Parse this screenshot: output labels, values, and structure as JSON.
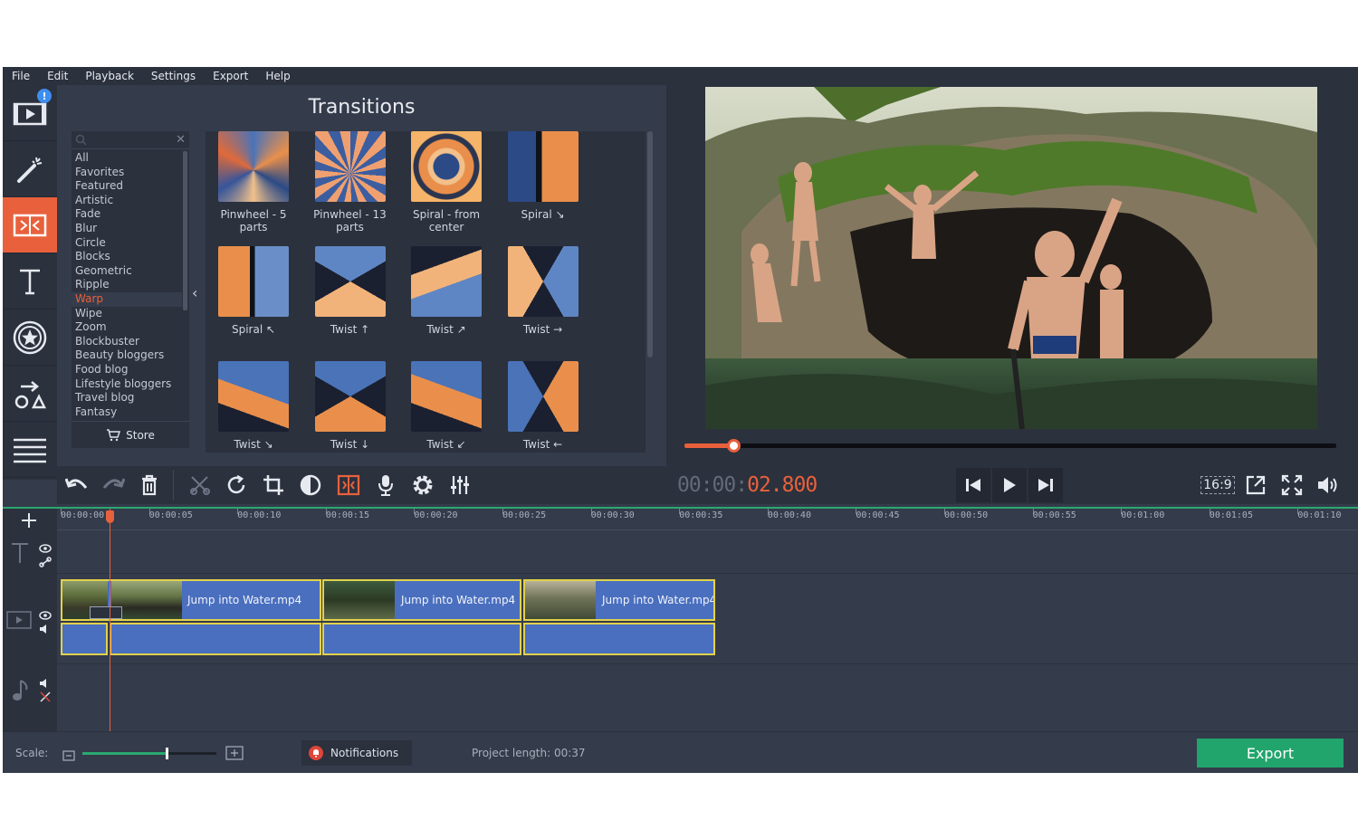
{
  "menu": [
    "File",
    "Edit",
    "Playback",
    "Settings",
    "Export",
    "Help"
  ],
  "left_tools": [
    {
      "icon": "import-media-icon",
      "badge": "!"
    },
    {
      "icon": "magic-wand-icon"
    },
    {
      "icon": "transitions-icon",
      "active": true
    },
    {
      "icon": "titles-icon"
    },
    {
      "icon": "stickers-icon"
    },
    {
      "icon": "shapes-icon"
    },
    {
      "icon": "more-menu-icon"
    }
  ],
  "transitions": {
    "title": "Transitions",
    "categories": [
      "All",
      "Favorites",
      "Featured",
      "Artistic",
      "Fade",
      "Blur",
      "Circle",
      "Blocks",
      "Geometric",
      "Ripple",
      "Warp",
      "Wipe",
      "Zoom",
      "Blockbuster",
      "Beauty bloggers",
      "Food blog",
      "Lifestyle bloggers",
      "Travel blog",
      "Fantasy"
    ],
    "active_category": "Warp",
    "store_label": "Store",
    "items": [
      {
        "label": "Pinwheel - 5 parts",
        "style": "pinwheel"
      },
      {
        "label": "Pinwheel - 13 parts",
        "style": "pinwheel13"
      },
      {
        "label": "Spiral - from center",
        "style": "spiralcenter"
      },
      {
        "label": "Spiral ↘",
        "style": "spiral1"
      },
      {
        "label": "Spiral ↖",
        "style": "spiral2"
      },
      {
        "label": "Twist ↑",
        "style": "twistup"
      },
      {
        "label": "Twist ↗",
        "style": "twistne"
      },
      {
        "label": "Twist →",
        "style": "twistr"
      },
      {
        "label": "Twist ↘",
        "style": "twistse"
      },
      {
        "label": "Twist ↓",
        "style": "twistdown"
      },
      {
        "label": "Twist ↙",
        "style": "twistsw"
      },
      {
        "label": "Twist ←",
        "style": "twistl"
      }
    ]
  },
  "player": {
    "timecode_dim": "00:00:",
    "timecode_hi": "02.800",
    "progress": 0.075,
    "aspect": "16:9"
  },
  "timeline": {
    "ticks": [
      "00:00:00",
      "00:00:05",
      "00:00:10",
      "00:00:15",
      "00:00:20",
      "00:00:25",
      "00:00:30",
      "00:00:35",
      "00:00:40",
      "00:00:45",
      "00:00:50",
      "00:00:55",
      "00:01:00",
      "00:01:05",
      "00:01:10"
    ],
    "clips": [
      {
        "name": "Jump into Water.mp4"
      },
      {
        "name": "Jump into Water.mp4"
      },
      {
        "name": "Jump into Water.mp4"
      }
    ]
  },
  "status": {
    "scale_label": "Scale:",
    "scale_value": 0.62,
    "notifications_label": "Notifications",
    "project_length": "Project length:  00:37",
    "export_label": "Export"
  },
  "colors": {
    "accent": "#e8613c",
    "export": "#22a56c",
    "clip": "#4a6fbf",
    "clip_border": "#e2d14c"
  }
}
